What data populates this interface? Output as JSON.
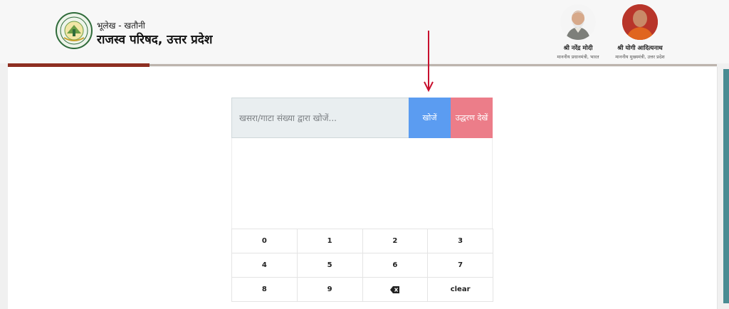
{
  "header": {
    "subtitle": "भूलेख - खतौनी",
    "title": "राजस्व परिषद, उत्तर प्रदेश",
    "logo_icon": "board-of-revenue-seal-logo",
    "leaders": [
      {
        "name": "श्री नरेंद्र मोदी",
        "designation": "माननीय प्रधानमंत्री, भारत"
      },
      {
        "name": "श्री योगी आदित्यनाथ",
        "designation": "माननीय मुख्यमंत्री, उत्तर प्रदेश"
      }
    ]
  },
  "search": {
    "placeholder": "खसरा/गाटा संख्या द्वारा खोजें...",
    "value": "",
    "search_label": "खोजें",
    "example_label": "उद्धरण देखें"
  },
  "keypad": {
    "keys": [
      "0",
      "1",
      "2",
      "3",
      "4",
      "5",
      "6",
      "7",
      "8",
      "9",
      "backspace",
      "clear"
    ],
    "backspace_icon": "backspace-icon"
  },
  "colors": {
    "accent_red": "#8e2f22",
    "search_button": "#5b9cf1",
    "example_button": "#ec7d89",
    "annotation_arrow": "#c8102e"
  }
}
